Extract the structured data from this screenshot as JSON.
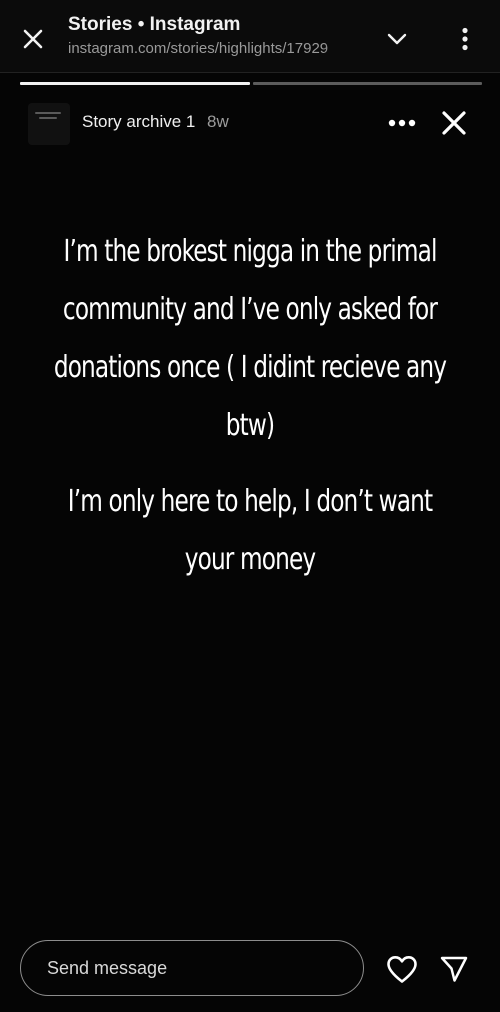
{
  "browser": {
    "title": "Stories • Instagram",
    "url": "instagram.com/stories/highlights/17929"
  },
  "story": {
    "progress": {
      "segments": 2,
      "current": 1
    },
    "title": "Story archive 1",
    "time_ago": "8w",
    "paragraphs": [
      "I’m the brokest nigga in the primal community and I’ve only asked for donations once ( I didint recieve any btw)",
      "I’m only here to help, I don’t want your money"
    ]
  },
  "reply": {
    "placeholder": "Send message"
  },
  "icons": {
    "close": "close-icon",
    "chevron": "chevron-down-icon",
    "menu": "more-vertical-icon",
    "more": "more-horizontal-icon",
    "heart": "heart-icon",
    "send": "send-icon"
  },
  "colors": {
    "background": "#000000",
    "text": "#ffffff",
    "muted": "#9c9c9c"
  }
}
